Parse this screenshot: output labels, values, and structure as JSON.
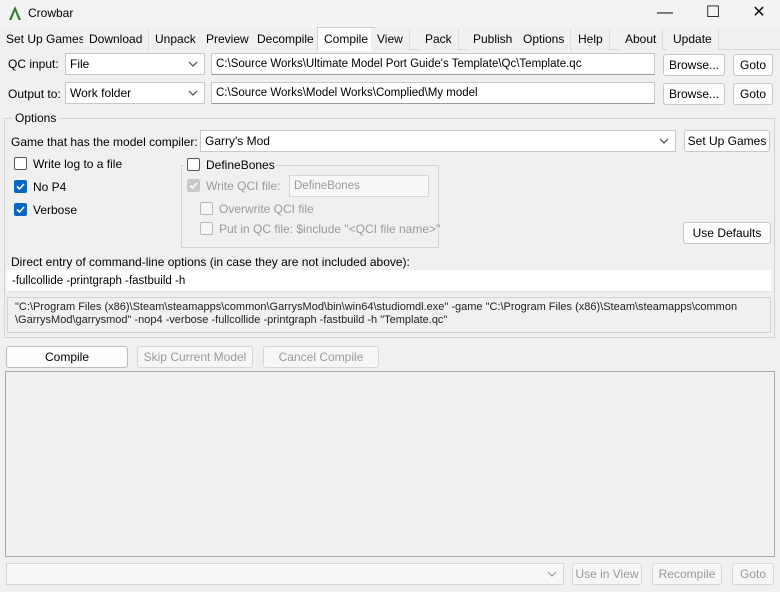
{
  "window": {
    "title": "Crowbar",
    "controls": {
      "minimize": "—",
      "maximize": "☐",
      "close": "✕"
    }
  },
  "tabs": [
    {
      "label": "Set Up Games"
    },
    {
      "label": "Download"
    },
    {
      "label": "Unpack"
    },
    {
      "label": "Preview"
    },
    {
      "label": "Decompile"
    },
    {
      "label": "Compile"
    },
    {
      "label": "View"
    },
    {
      "label": "Pack"
    },
    {
      "label": "Publish"
    },
    {
      "label": "Options"
    },
    {
      "label": "Help"
    },
    {
      "label": "About"
    },
    {
      "label": "Update"
    }
  ],
  "active_tab": "Compile",
  "qc_input": {
    "label": "QC input:",
    "mode": "File",
    "path": "C:\\Source Works\\Ultimate Model Port Guide's Template\\Qc\\Template.qc",
    "browse": "Browse...",
    "goto": "Goto"
  },
  "output_to": {
    "label": "Output to:",
    "mode": "Work folder",
    "path": "C:\\Source Works\\Model Works\\Complied\\My model",
    "browse": "Browse...",
    "goto": "Goto"
  },
  "options": {
    "title": "Options",
    "game_label": "Game that has the model compiler:",
    "game_value": "Garry's Mod",
    "setup_games_button": "Set Up Games",
    "write_log": {
      "label": "Write log to a file",
      "checked": false
    },
    "no_p4": {
      "label": "No P4",
      "checked": true
    },
    "verbose": {
      "label": "Verbose",
      "checked": true
    },
    "definebones": {
      "label": "DefineBones",
      "checked": false,
      "write_qci": {
        "label": "Write QCI file:",
        "checked": true,
        "value": "DefineBones"
      },
      "overwrite_qci": {
        "label": "Overwrite QCI file",
        "checked": false
      },
      "put_in_qc": {
        "label": "Put in QC file: $include \"<QCI file name>\"",
        "checked": false
      }
    },
    "use_defaults_button": "Use Defaults",
    "direct_entry_label": "Direct entry of command-line options (in case they are not included above):",
    "direct_entry_value": "-fullcollide -printgraph -fastbuild -h",
    "command_line_1": "\"C:\\Program Files (x86)\\Steam\\steamapps\\common\\GarrysMod\\bin\\win64\\studiomdl.exe\" -game \"C:\\Program Files (x86)\\Steam\\steamapps\\common",
    "command_line_2": "\\GarrysMod\\garrysmod\" -nop4 -verbose -fullcollide -printgraph -fastbuild -h \"Template.qc\""
  },
  "actions": {
    "compile": "Compile",
    "skip": "Skip Current Model",
    "cancel": "Cancel Compile"
  },
  "bottom": {
    "combo_value": "",
    "use_in_view": "Use in View",
    "recompile": "Recompile",
    "goto": "Goto"
  },
  "colors": {
    "accent": "#0a66c2",
    "logo": "#2e7d32"
  }
}
